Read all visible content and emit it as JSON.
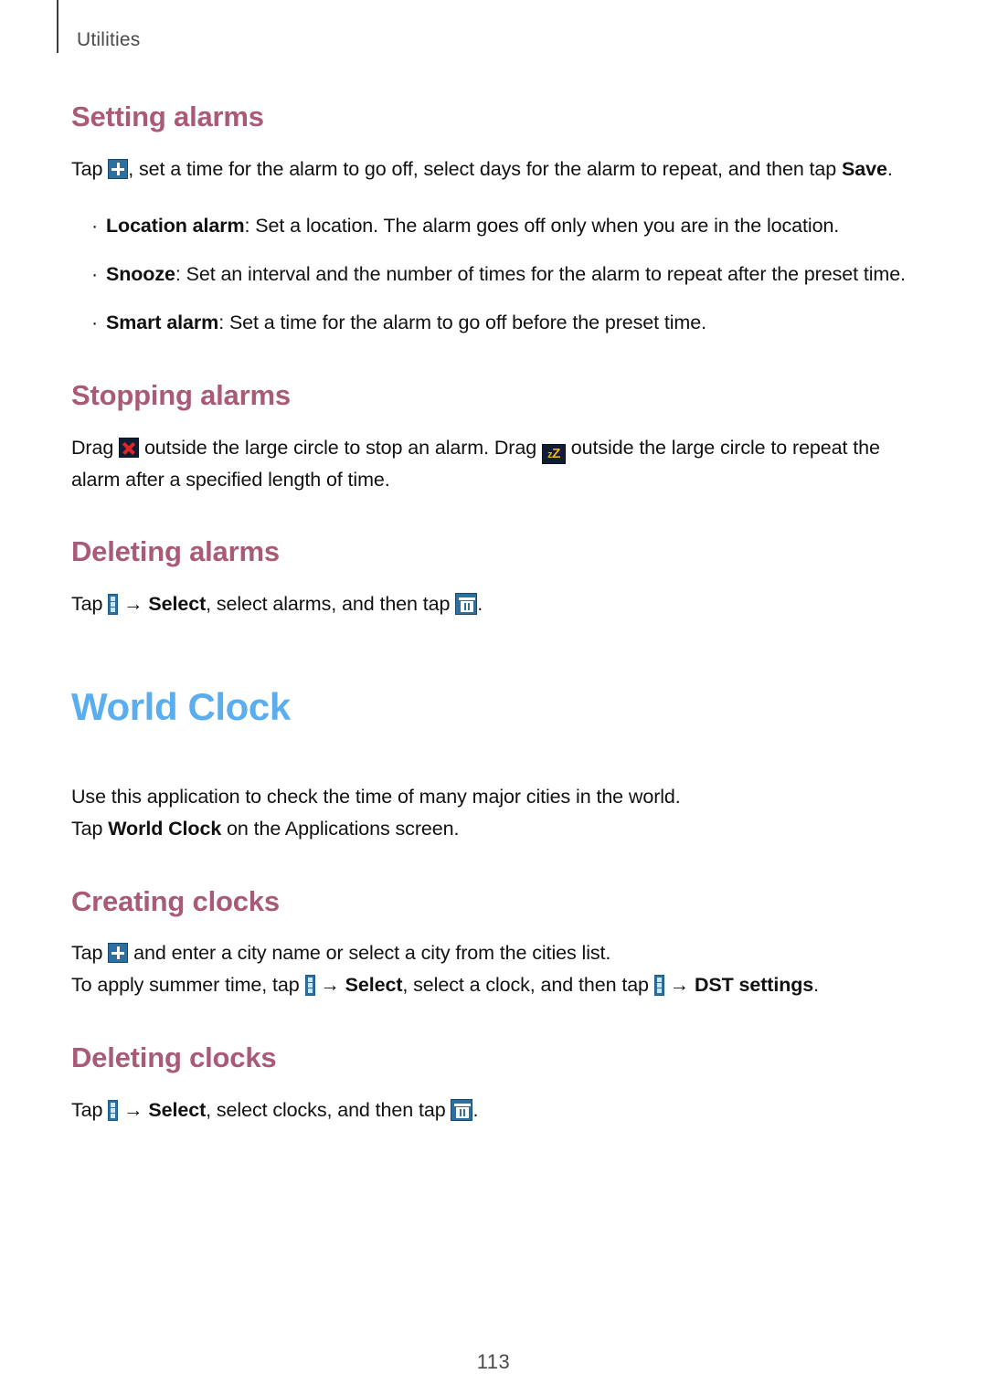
{
  "header": {
    "running_head": "Utilities"
  },
  "sections": [
    {
      "id": "setting-alarms",
      "heading": "Setting alarms",
      "paragraph": {
        "before_icon": "Tap ",
        "icon": "plus-icon",
        "after_icon": ", set a time for the alarm to go off, select days for the alarm to repeat, and then tap ",
        "bold_tail": "Save",
        "period": "."
      },
      "bullets": [
        {
          "term": "Location alarm",
          "separator": ": ",
          "text": "Set a location. The alarm goes off only when you are in the location."
        },
        {
          "term": "Snooze",
          "separator": ": ",
          "text": "Set an interval and the number of times for the alarm to repeat after the preset time."
        },
        {
          "term": "Smart alarm",
          "separator": ": ",
          "text": "Set a time for the alarm to go off before the preset time."
        }
      ]
    },
    {
      "id": "stopping-alarms",
      "heading": "Stopping alarms",
      "paragraph": {
        "part1": "Drag ",
        "icon1": "dismiss-x-icon",
        "part2": " outside the large circle to stop an alarm. Drag ",
        "icon2": "snooze-zz-icon",
        "part3": " outside the large circle to repeat the alarm after a specified length of time."
      }
    },
    {
      "id": "deleting-alarms",
      "heading": "Deleting alarms",
      "paragraph": {
        "part1": "Tap ",
        "icon1": "more-options-icon",
        "arrow": "→",
        "bold1": "Select",
        "part2": ", select alarms, and then tap ",
        "icon2": "trash-icon",
        "part3": "."
      }
    }
  ],
  "app": {
    "title": "World Clock",
    "intro_line1": "Use this application to check the time of many major cities in the world.",
    "intro_line2": {
      "part1": "Tap ",
      "bold1": "World Clock",
      "part2": " on the Applications screen."
    },
    "sections": [
      {
        "id": "creating-clocks",
        "heading": "Creating clocks",
        "paragraph1": {
          "part1": "Tap ",
          "icon1": "plus-icon",
          "part2": " and enter a city name or select a city from the cities list."
        },
        "paragraph2": {
          "part1": "To apply summer time, tap ",
          "icon1": "more-options-icon",
          "arrow1": "→",
          "bold1": "Select",
          "part2": ", select a clock, and then tap ",
          "icon2": "more-options-icon",
          "arrow2": "→",
          "bold2": "DST settings",
          "part3": "."
        }
      },
      {
        "id": "deleting-clocks",
        "heading": "Deleting clocks",
        "paragraph": {
          "part1": "Tap ",
          "icon1": "more-options-icon",
          "arrow": "→",
          "bold1": "Select",
          "part2": ", select clocks, and then tap ",
          "icon2": "trash-icon",
          "part3": "."
        }
      }
    ]
  },
  "folio": {
    "page_number": "113"
  },
  "colors": {
    "subheading": "#a85a77",
    "app_title": "#5aaef0",
    "body_text": "#111111",
    "running_head": "#4a4a4a",
    "icon_blue": "#2d6f9e",
    "icon_dark": "#101d33",
    "icon_red": "#e02424",
    "icon_yellow": "#f2b418"
  }
}
